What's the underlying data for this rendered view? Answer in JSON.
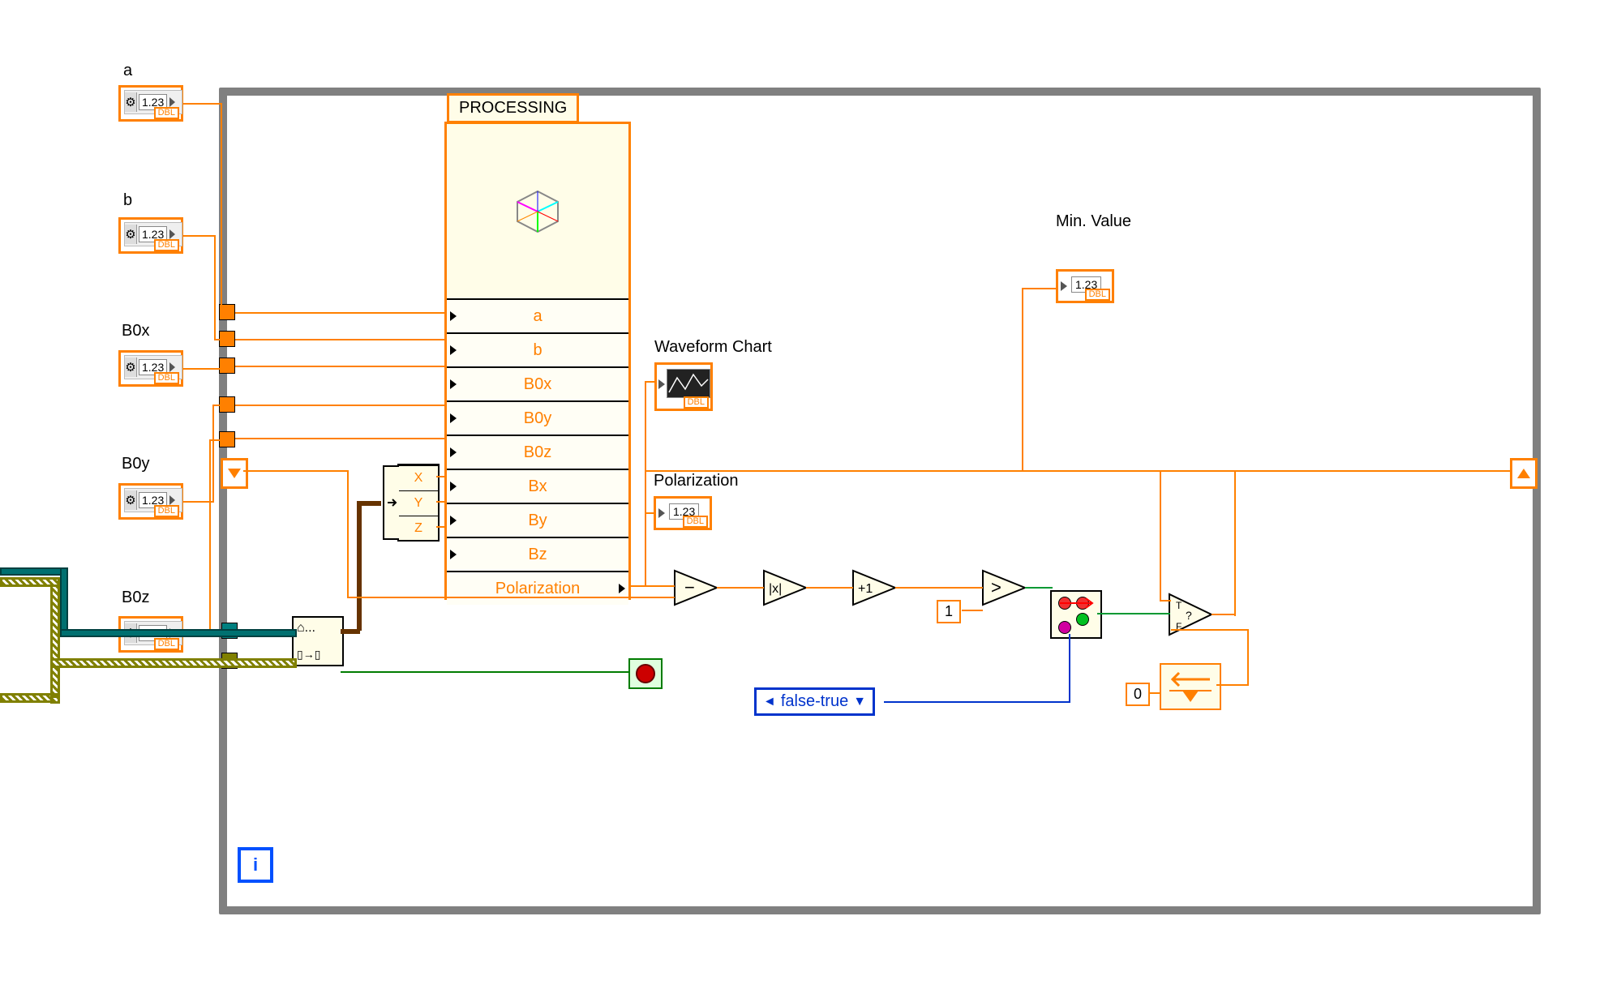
{
  "controls": {
    "a": {
      "label": "a",
      "value": "1.23",
      "type": "DBL"
    },
    "b": {
      "label": "b",
      "value": "1.23",
      "type": "DBL"
    },
    "B0x": {
      "label": "B0x",
      "value": "1.23",
      "type": "DBL"
    },
    "B0y": {
      "label": "B0y",
      "value": "1.23",
      "type": "DBL"
    },
    "B0z": {
      "label": "B0z",
      "value": "1.23",
      "type": "DBL"
    }
  },
  "indicators": {
    "waveform_chart": {
      "label": "Waveform Chart",
      "type": "DBL"
    },
    "polarization": {
      "label": "Polarization",
      "value": "1.23",
      "type": "DBL"
    },
    "min_value": {
      "label": "Min. Value",
      "value": "1.23",
      "type": "DBL"
    }
  },
  "express_vi": {
    "title": "PROCESSING",
    "inputs": [
      "a",
      "b",
      "B0x",
      "B0y",
      "B0z",
      "Bx",
      "By",
      "Bz"
    ],
    "outputs": [
      "Polarization"
    ]
  },
  "unbundle": {
    "items": [
      "X",
      "Y",
      "Z"
    ]
  },
  "ring_constant": "false-true",
  "numeric_constant_1": "1",
  "numeric_constant_0": "0",
  "loop_terminal": "i",
  "queue_node_top": "⌂...",
  "queue_node_bottom": "▯→▯",
  "nodes": {
    "subtract": "-",
    "abs": "|·|",
    "increment": "+1",
    "greater": ">",
    "select": "select"
  }
}
